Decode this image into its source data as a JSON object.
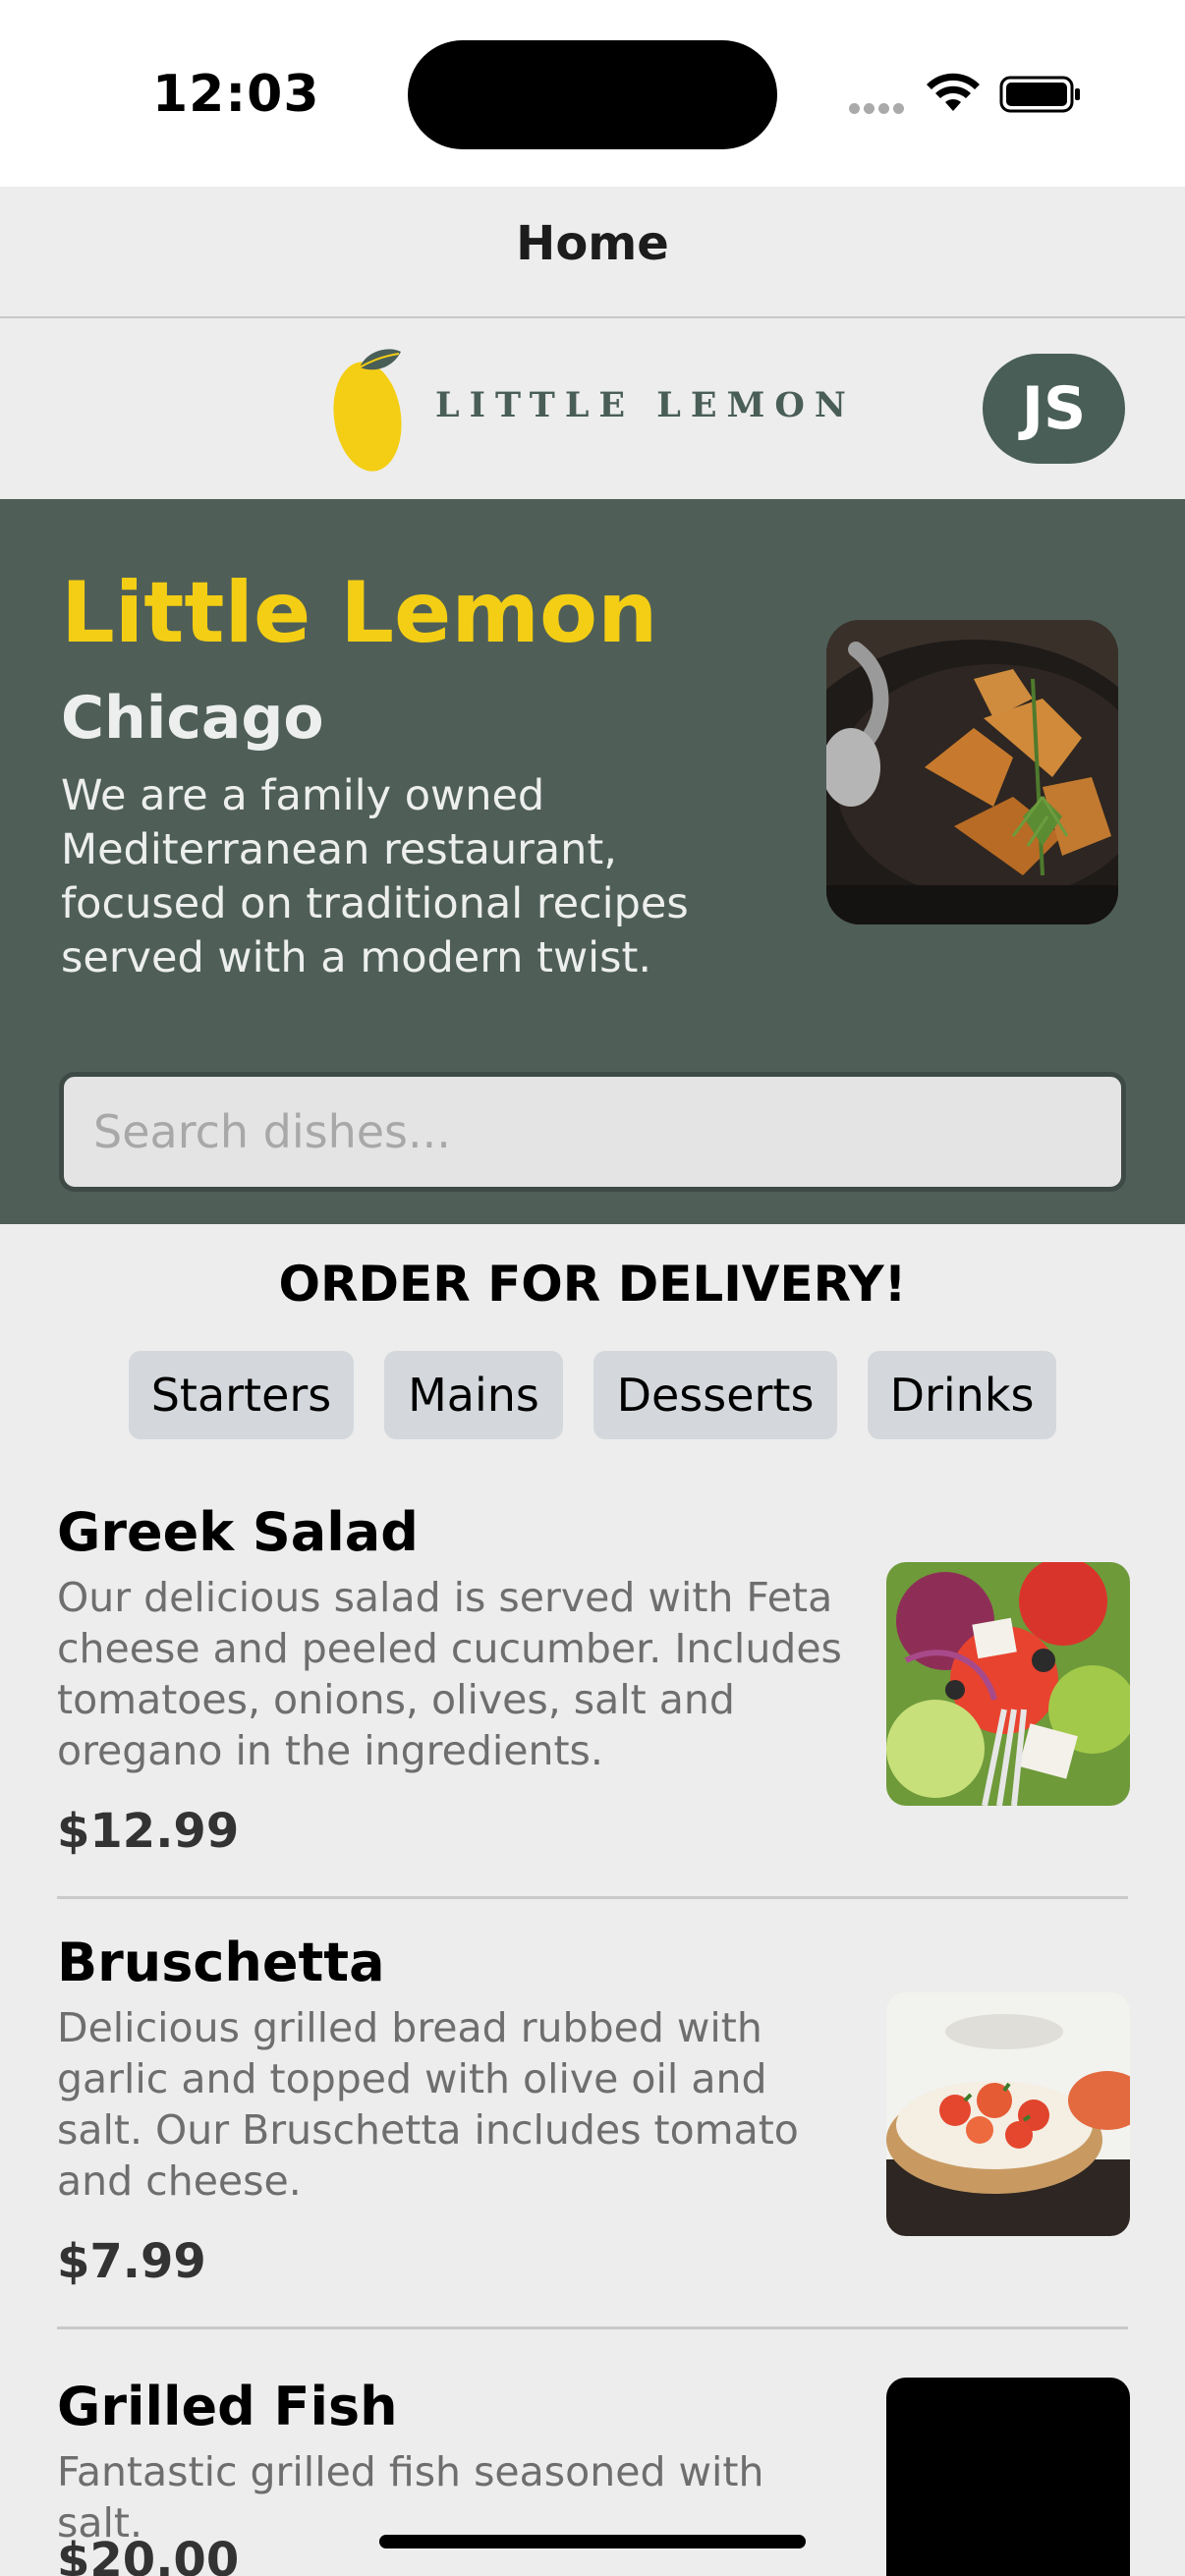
{
  "status": {
    "time": "12:03"
  },
  "nav": {
    "title": "Home"
  },
  "header": {
    "logo_text": "LITTLE LEMON",
    "avatar_initials": "JS"
  },
  "hero": {
    "title": "Little Lemon",
    "city": "Chicago",
    "description": "We are a family owned Mediterranean restaurant, focused on traditional recipes served with a modern twist."
  },
  "search": {
    "placeholder": "Search dishes...",
    "value": ""
  },
  "order": {
    "title": "ORDER FOR DELIVERY!",
    "categories": [
      "Starters",
      "Mains",
      "Desserts",
      "Drinks"
    ]
  },
  "menu": [
    {
      "name": "Greek Salad",
      "description": "Our delicious salad is served with Feta cheese and peeled cucumber. Includes tomatoes, onions, olives, salt and oregano in the ingredients.",
      "price": "$12.99"
    },
    {
      "name": "Bruschetta",
      "description": "Delicious grilled bread rubbed with garlic and topped with olive oil and salt. Our Bruschetta includes tomato and cheese.",
      "price": "$7.99"
    },
    {
      "name": "Grilled Fish",
      "description": "Fantastic grilled fish seasoned with salt.",
      "price": "$20.00"
    }
  ],
  "colors": {
    "primary_green": "#495E57",
    "primary_yellow": "#F4CE14",
    "hero_bg": "#4F5F58",
    "page_bg": "#EDEDED"
  }
}
